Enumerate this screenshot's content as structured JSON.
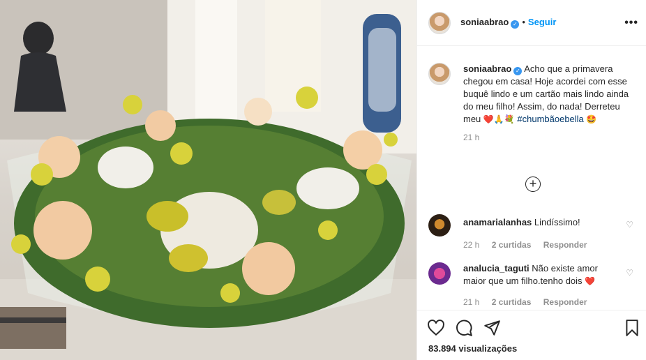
{
  "post": {
    "username": "soniaabrao",
    "verified_mark": "✓",
    "separator": "•",
    "follow_label": "Seguir",
    "more_label": "•••"
  },
  "caption": {
    "username": "soniaabrao",
    "text": "Acho que a primavera chegou em casa! Hoje acordei com esse buquê lindo e um cartão mais lindo ainda do meu filho! Assim, do nada! Derreteu meu",
    "emojis": "❤️🙏💐",
    "hashtag": "#chumbãoebella",
    "trailing_emoji": "🤩",
    "time": "21 h"
  },
  "load_more_label": "+",
  "comments": [
    {
      "username": "anamarialanhas",
      "text": "Lindíssimo!",
      "time": "22 h",
      "likes": "2 curtidas",
      "reply": "Responder"
    },
    {
      "username": "analucia_taguti",
      "text": "Não existe amor maior que um filho.tenho dois",
      "emoji": "❤️",
      "time": "21 h",
      "likes": "2 curtidas",
      "reply": "Responder"
    }
  ],
  "footer": {
    "views": "83.894 visualizações"
  },
  "icons": {
    "like": "heart-icon",
    "comment": "comment-icon",
    "share": "share-icon",
    "save": "bookmark-icon"
  },
  "colors": {
    "link": "#0095f6",
    "hashtag": "#00376b",
    "muted": "#8e8e8e"
  }
}
